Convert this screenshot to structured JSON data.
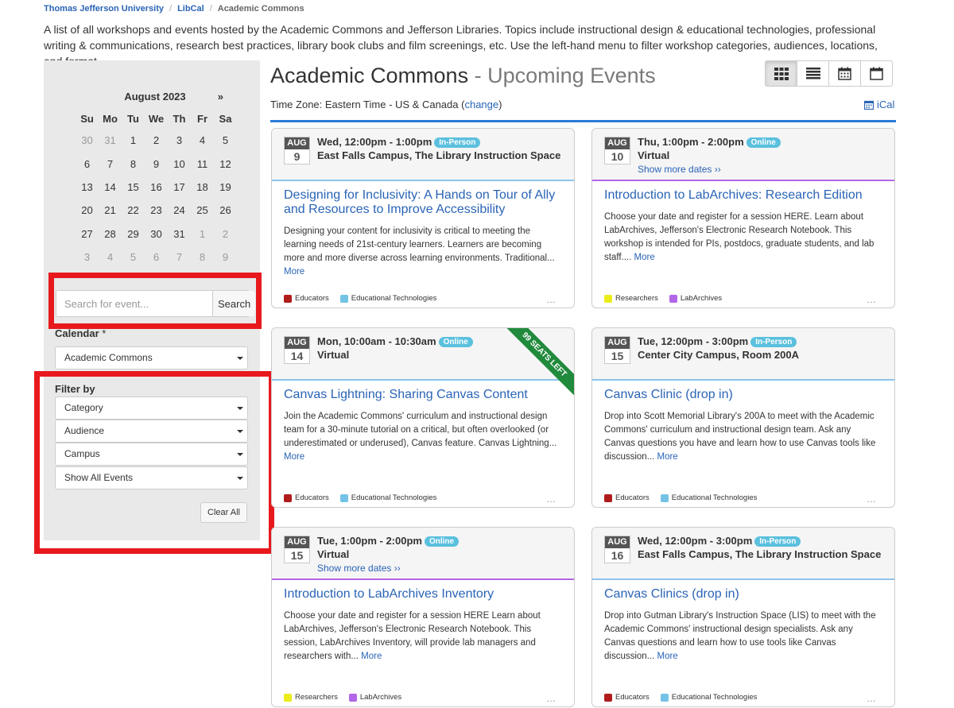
{
  "breadcrumb": [
    "Thomas Jefferson University",
    "LibCal",
    "Academic Commons"
  ],
  "intro": "A list of all workshops and events hosted by the Academic Commons and Jefferson Libraries. Topics include instructional design & educational technologies, professional writing & communications, research best practices, library book clubs and film screenings, etc. Use the left-hand menu to filter workshop categories, audiences, locations, and format.",
  "sidebar": {
    "calendar": {
      "month": "August 2023",
      "next": "»",
      "weekdays": [
        "Su",
        "Mo",
        "Tu",
        "We",
        "Th",
        "Fr",
        "Sa"
      ],
      "weeks": [
        [
          "30",
          "31",
          "1",
          "2",
          "3",
          "4",
          "5"
        ],
        [
          "6",
          "7",
          "8",
          "9",
          "10",
          "11",
          "12"
        ],
        [
          "13",
          "14",
          "15",
          "16",
          "17",
          "18",
          "19"
        ],
        [
          "20",
          "21",
          "22",
          "23",
          "24",
          "25",
          "26"
        ],
        [
          "27",
          "28",
          "29",
          "30",
          "31",
          "1",
          "2"
        ],
        [
          "3",
          "4",
          "5",
          "6",
          "7",
          "8",
          "9"
        ]
      ]
    },
    "search": {
      "placeholder": "Search for event...",
      "button": "Search"
    },
    "calendar_label": "Calendar",
    "calendar_required": "*",
    "calendar_select": "Academic Commons",
    "filter_label": "Filter by",
    "filters": [
      "Category",
      "Audience",
      "Campus",
      "Show All Events"
    ],
    "clear": "Clear All"
  },
  "main": {
    "title": "Academic Commons",
    "title_sep": " - ",
    "subtitle": "Upcoming Events",
    "timezone": "Time Zone: Eastern Time - US & Canada",
    "change": "change",
    "ical": "iCal",
    "accent": "#2a7ad6"
  },
  "events": [
    {
      "month": "AUG",
      "day": "9",
      "time": "Wed, 12:00pm - 1:00pm",
      "badge": "In-Person",
      "location": "East Falls Campus, The Library Instruction Space",
      "show_more": "",
      "title": "Designing for Inclusivity: A Hands on Tour of Ally and Resources to Improve Accessibility",
      "description": "Designing your content for inclusivity is critical to meeting the learning needs of 21st-century learners. Learners are becoming more and more diverse across learning environments. Traditional...",
      "more": "More",
      "tags": [
        {
          "label": "Educators",
          "color": "#b01c1c"
        },
        {
          "label": "Educational Technologies",
          "color": "#74c3e6"
        }
      ],
      "rule_color": "#8cc4ea",
      "ribbon": ""
    },
    {
      "month": "AUG",
      "day": "10",
      "time": "Thu, 1:00pm - 2:00pm",
      "badge": "Online",
      "location": "Virtual",
      "show_more": "Show more dates ››",
      "title": "Introduction to LabArchives: Research Edition",
      "description": "Choose your date and register for a session HERE. Learn about LabArchives, Jefferson's Electronic Research Notebook. This workshop is intended for PIs, postdocs, graduate students, and lab staff....",
      "more": "More",
      "tags": [
        {
          "label": "Researchers",
          "color": "#ecec1c"
        },
        {
          "label": "LabArchives",
          "color": "#b267e6"
        }
      ],
      "rule_color": "#b267e6",
      "ribbon": ""
    },
    {
      "month": "AUG",
      "day": "14",
      "time": "Mon, 10:00am - 10:30am",
      "badge": "Online",
      "location": "Virtual",
      "show_more": "",
      "title": "Canvas Lightning: Sharing Canvas Content",
      "description": "Join the Academic Commons' curriculum and instructional design team for a 30-minute tutorial on a critical, but often overlooked (or underestimated or underused), Canvas feature. Canvas Lightning...",
      "more": "More",
      "tags": [
        {
          "label": "Educators",
          "color": "#b01c1c"
        },
        {
          "label": "Educational Technologies",
          "color": "#74c3e6"
        }
      ],
      "rule_color": "#8cc4ea",
      "ribbon": "99 SEATS LEFT"
    },
    {
      "month": "AUG",
      "day": "15",
      "time": "Tue, 12:00pm - 3:00pm",
      "badge": "In-Person",
      "location": "Center City Campus, Room 200A",
      "show_more": "",
      "title": "Canvas Clinic (drop in)",
      "description": "Drop into Scott Memorial Library's 200A to meet with the Academic Commons' curriculum and instructional design team. Ask any Canvas questions you have and learn how to use Canvas tools like discussion...",
      "more": "More",
      "tags": [
        {
          "label": "Educators",
          "color": "#b01c1c"
        },
        {
          "label": "Educational Technologies",
          "color": "#74c3e6"
        }
      ],
      "rule_color": "#8cc4ea",
      "ribbon": ""
    },
    {
      "month": "AUG",
      "day": "15",
      "time": "Tue, 1:00pm - 2:00pm",
      "badge": "Online",
      "location": "Virtual",
      "show_more": "Show more dates ››",
      "title": "Introduction to LabArchives Inventory",
      "description": "Choose your date and register for a session HERE Learn about LabArchives, Jefferson's Electronic Research Notebook. This session, LabArchives Inventory, will provide lab managers and researchers with...",
      "more": "More",
      "tags": [
        {
          "label": "Researchers",
          "color": "#ecec1c"
        },
        {
          "label": "LabArchives",
          "color": "#b267e6"
        }
      ],
      "rule_color": "#b267e6",
      "ribbon": ""
    },
    {
      "month": "AUG",
      "day": "16",
      "time": "Wed, 12:00pm - 3:00pm",
      "badge": "In-Person",
      "location": "East Falls Campus, The Library Instruction Space",
      "show_more": "",
      "title": "Canvas Clinics (drop in)",
      "description": "Drop into Gutman Library's Instruction Space (LIS) to meet with the Academic Commons' instructional design specialists. Ask any Canvas questions and learn how to use tools like Canvas discussion...",
      "more": "More",
      "tags": [
        {
          "label": "Educators",
          "color": "#b01c1c"
        },
        {
          "label": "Educational Technologies",
          "color": "#74c3e6"
        }
      ],
      "rule_color": "#8cc4ea",
      "ribbon": ""
    }
  ],
  "badge_colors": {
    "In-Person": "#5bc0de",
    "Online": "#5bc0de"
  },
  "highlight_color": "#e8191d"
}
